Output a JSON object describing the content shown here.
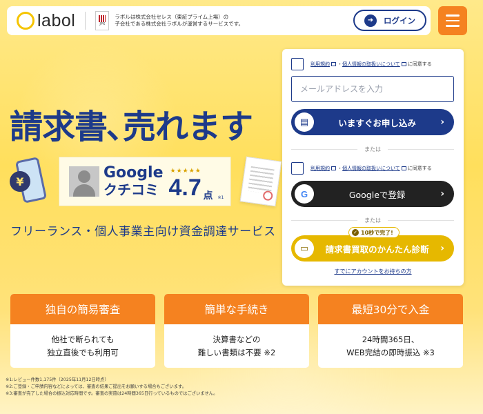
{
  "header": {
    "logo_text": "labol",
    "jpx_label": "JPX",
    "company_note_line1": "ラボルは株式会社セレス（東証プライム上場）の",
    "company_note_line2": "子会社である株式会社ラボルが運営するサービスです。",
    "login_label": "ログイン"
  },
  "hero": {
    "title": "請求書､売れます",
    "yen_symbol": "¥",
    "review_google": "Google",
    "review_kuchikomi": "クチコミ",
    "stars": "★★★★★",
    "rating": "4.7",
    "rating_unit": "点",
    "rating_note": "※1",
    "subtitle": "フリーランス・個人事業主向け資金調達サービス"
  },
  "form": {
    "terms_link": "利用規約",
    "separator": "・",
    "privacy_link": "個人情報の取扱いについて",
    "agree_suffix": "に同意する",
    "email_placeholder": "メールアドレスを入力",
    "apply_label": "いますぐお申し込み",
    "or_label": "または",
    "google_label": "Googleで登録",
    "badge_label": "10秒で完了!",
    "diagnosis_label": "請求書買取のかんたん診断",
    "have_account_label": "すでにアカウントをお持ちの方"
  },
  "features": [
    {
      "title": "独自の簡易審査",
      "body": "他社で断られても\n独立直後でも利用可"
    },
    {
      "title": "簡単な手続き",
      "body": "決算書などの\n難しい書類は不要 ※2"
    },
    {
      "title": "最短30分で入金",
      "body": "24時間365日、\nWEB完結の即時振込 ※3"
    }
  ],
  "footnotes": [
    "※1:レビュー件数1,175件（2025年11月12日時点）",
    "※2:ご登録・ご申請内容などによっては、審査の結果ご提出をお願いする場合もございます。",
    "※3:審査が完了した場合の振込対応時間です。審査の実施は24時間365日行っているものではございません。"
  ],
  "colors": {
    "brand_navy": "#1d3a8a",
    "accent_orange": "#f58220",
    "accent_yellow": "#e6b800",
    "logo_yellow": "#f5c400"
  },
  "icons": {
    "login": "login-arrow-icon",
    "menu": "hamburger-icon",
    "apply": "document-icon",
    "google": "google-g-icon",
    "diagnosis": "laptop-icon",
    "chevron": "chevron-right-icon"
  }
}
